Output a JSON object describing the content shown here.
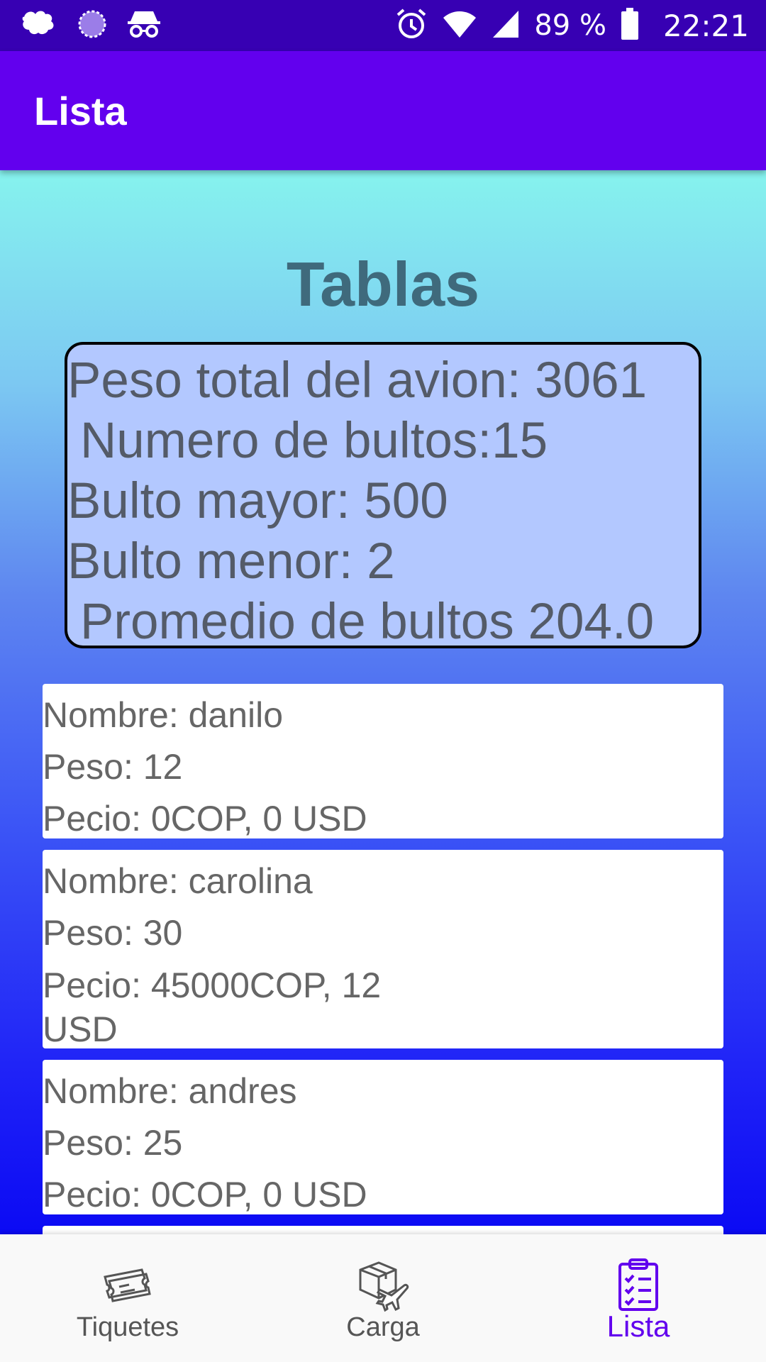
{
  "status_bar": {
    "battery_percent": "89 %",
    "time": "22:21",
    "icons": [
      "app-notification-icon",
      "loading-circle-icon",
      "incognito-icon",
      "alarm-icon",
      "wifi-icon",
      "cell-signal-icon",
      "battery-icon"
    ]
  },
  "app_bar": {
    "title": "Lista"
  },
  "main": {
    "heading": "Tablas",
    "summary": {
      "total_weight": "Peso total del avion: 3061",
      "package_count": "Numero de bultos:15",
      "largest": "Bulto mayor: 500",
      "smallest": "Bulto menor: 2",
      "average": "Promedio de bultos 204.0"
    },
    "items": [
      {
        "nombre": "Nombre: danilo",
        "peso": "Peso: 12",
        "precio": "Pecio: 0COP, 0 USD"
      },
      {
        "nombre": "Nombre: carolina",
        "peso": "Peso: 30",
        "precio": "Pecio: 45000COP, 12 USD"
      },
      {
        "nombre": "Nombre: andres",
        "peso": "Peso: 25",
        "precio": "Pecio: 0COP, 0 USD"
      }
    ]
  },
  "bottom_nav": {
    "items": [
      {
        "label": "Tiquetes",
        "icon": "ticket-icon",
        "active": false
      },
      {
        "label": "Carga",
        "icon": "cargo-plane-icon",
        "active": false
      },
      {
        "label": "Lista",
        "icon": "clipboard-list-icon",
        "active": true
      }
    ]
  },
  "colors": {
    "status_bar": "#3700b3",
    "app_bar": "#6200ee",
    "accent": "#6200ee",
    "summary_bg": "#b3c8ff",
    "gradient_top": "#86f3ee",
    "gradient_bottom": "#0b0af4"
  }
}
